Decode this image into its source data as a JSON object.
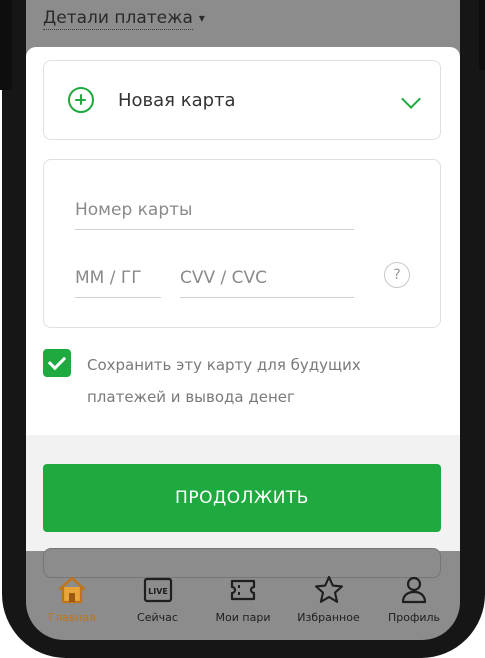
{
  "header": {
    "payment_details_label": "Детали платежа"
  },
  "card_selector": {
    "label": "Новая карта"
  },
  "card_form": {
    "card_number_placeholder": "Номер карты",
    "expiry_placeholder": "ММ / ГГ",
    "cvv_placeholder": "CVV / CVC",
    "help_label": "?"
  },
  "save_card": {
    "checked": true,
    "line1": "Сохранить эту карту для будущих",
    "line2": "платежей и вывода денег"
  },
  "continue_button": {
    "label": "ПРОДОЛЖИТЬ"
  },
  "bottom_nav": {
    "items": [
      {
        "label": "Главная",
        "icon": "home-icon",
        "active": true
      },
      {
        "label": "Сейчас",
        "icon": "live-icon",
        "active": false,
        "badge": "LIVE"
      },
      {
        "label": "Мои пари",
        "icon": "ticket-icon",
        "active": false
      },
      {
        "label": "Избранное",
        "icon": "star-icon",
        "active": false
      },
      {
        "label": "Профиль",
        "icon": "profile-icon",
        "active": false
      }
    ]
  },
  "colors": {
    "accent_green": "#1faa3f",
    "active_nav": "#c0741a",
    "dim_overlay": "#8c8c8c"
  }
}
